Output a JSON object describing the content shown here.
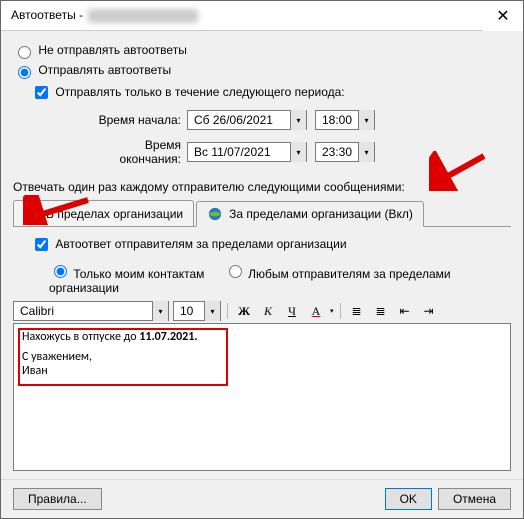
{
  "window": {
    "title_prefix": "Автоответы - "
  },
  "radios": {
    "no_send": "Не отправлять автоответы",
    "send": "Отправлять автоответы"
  },
  "period": {
    "checkbox": "Отправлять только в течение следующего периода:",
    "start_label": "Время начала:",
    "start_date": "Сб 26/06/2021",
    "start_time": "18:00",
    "end_label": "Время окончания:",
    "end_date": "Вс 11/07/2021",
    "end_time": "23:30"
  },
  "reply_label": "Отвечать один раз каждому отправителю следующими сообщениями:",
  "tabs": {
    "inside": "В пределах организации",
    "outside": "За пределами организации (Вкл)"
  },
  "outside": {
    "checkbox": "Автоответ отправителям за пределами организации",
    "only_contacts": "Только моим контактам",
    "any_sender": "Любым отправителям за пределами организации"
  },
  "toolbar": {
    "font": "Calibri",
    "size": "10",
    "bold": "Ж",
    "italic": "К",
    "underline": "Ч"
  },
  "message": {
    "line1a": "Нахожусь в отпуске до ",
    "line1b": "11.07.2021.",
    "line2": "С уважением,",
    "line3": "Иван"
  },
  "footer": {
    "rules": "Правила...",
    "ok": "OK",
    "cancel": "Отмена"
  }
}
